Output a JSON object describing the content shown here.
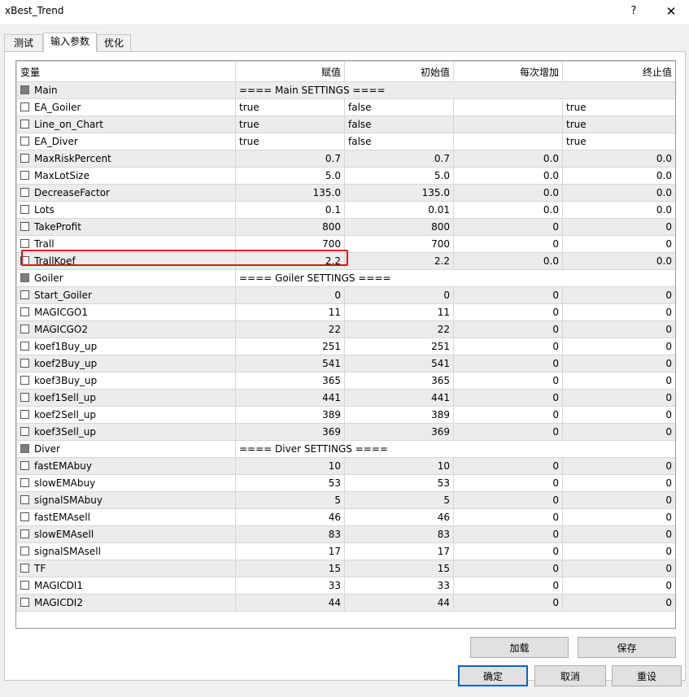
{
  "window": {
    "title": "xBest_Trend",
    "help": "?",
    "close": "✕"
  },
  "tabs": [
    {
      "label": "测试"
    },
    {
      "label": "输入参数"
    },
    {
      "label": "优化"
    }
  ],
  "columns": {
    "name": "变量",
    "value": "赋值",
    "start": "初始值",
    "step": "每次增加",
    "stop": "终止值"
  },
  "rows": [
    {
      "name": "Main",
      "group": true,
      "title": "==== Main SETTINGS ===="
    },
    {
      "name": "EA_Goiler",
      "value": "true",
      "start": "false",
      "step": "",
      "stop": "true",
      "text": true
    },
    {
      "name": "Line_on_Chart",
      "value": "true",
      "start": "false",
      "step": "",
      "stop": "true",
      "text": true
    },
    {
      "name": "EA_Diver",
      "value": "true",
      "start": "false",
      "step": "",
      "stop": "true",
      "text": true
    },
    {
      "name": "MaxRiskPercent",
      "value": "0.7",
      "start": "0.7",
      "step": "0.0",
      "stop": "0.0"
    },
    {
      "name": "MaxLotSize",
      "value": "5.0",
      "start": "5.0",
      "step": "0.0",
      "stop": "0.0"
    },
    {
      "name": "DecreaseFactor",
      "value": "135.0",
      "start": "135.0",
      "step": "0.0",
      "stop": "0.0"
    },
    {
      "name": "Lots",
      "value": "0.1",
      "start": "0.01",
      "step": "0.0",
      "stop": "0.0"
    },
    {
      "name": "TakeProfit",
      "value": "800",
      "start": "800",
      "step": "0",
      "stop": "0"
    },
    {
      "name": "Trall",
      "value": "700",
      "start": "700",
      "step": "0",
      "stop": "0"
    },
    {
      "name": "TrallKoef",
      "value": "2.2",
      "start": "2.2",
      "step": "0.0",
      "stop": "0.0"
    },
    {
      "name": "Goiler",
      "group": true,
      "title": "==== Goiler SETTINGS  ===="
    },
    {
      "name": "Start_Goiler",
      "value": "0",
      "start": "0",
      "step": "0",
      "stop": "0"
    },
    {
      "name": "MAGICGO1",
      "value": "11",
      "start": "11",
      "step": "0",
      "stop": "0"
    },
    {
      "name": "MAGICGO2",
      "value": "22",
      "start": "22",
      "step": "0",
      "stop": "0"
    },
    {
      "name": "koef1Buy_up",
      "value": "251",
      "start": "251",
      "step": "0",
      "stop": "0"
    },
    {
      "name": "koef2Buy_up",
      "value": "541",
      "start": "541",
      "step": "0",
      "stop": "0"
    },
    {
      "name": "koef3Buy_up",
      "value": "365",
      "start": "365",
      "step": "0",
      "stop": "0"
    },
    {
      "name": "koef1Sell_up",
      "value": "441",
      "start": "441",
      "step": "0",
      "stop": "0"
    },
    {
      "name": "koef2Sell_up",
      "value": "389",
      "start": "389",
      "step": "0",
      "stop": "0"
    },
    {
      "name": "koef3Sell_up",
      "value": "369",
      "start": "369",
      "step": "0",
      "stop": "0"
    },
    {
      "name": "Diver",
      "group": true,
      "title": "==== Diver SETTINGS ===="
    },
    {
      "name": "fastEMAbuy",
      "value": "10",
      "start": "10",
      "step": "0",
      "stop": "0"
    },
    {
      "name": "slowEMAbuy",
      "value": "53",
      "start": "53",
      "step": "0",
      "stop": "0"
    },
    {
      "name": "signalSMAbuy",
      "value": "5",
      "start": "5",
      "step": "0",
      "stop": "0"
    },
    {
      "name": "fastEMAsell",
      "value": "46",
      "start": "46",
      "step": "0",
      "stop": "0"
    },
    {
      "name": "slowEMAsell",
      "value": "83",
      "start": "83",
      "step": "0",
      "stop": "0"
    },
    {
      "name": "signalSMAsell",
      "value": "17",
      "start": "17",
      "step": "0",
      "stop": "0"
    },
    {
      "name": "TF",
      "value": "15",
      "start": "15",
      "step": "0",
      "stop": "0"
    },
    {
      "name": "MAGICDI1",
      "value": "33",
      "start": "33",
      "step": "0",
      "stop": "0"
    },
    {
      "name": "MAGICDI2",
      "value": "44",
      "start": "44",
      "step": "0",
      "stop": "0"
    }
  ],
  "buttons": {
    "load": "加载",
    "save": "保存",
    "ok": "确定",
    "cancel": "取消",
    "reset": "重设"
  },
  "colors": {
    "highlight": "#e0101a",
    "primary_border": "#0a64c8"
  }
}
